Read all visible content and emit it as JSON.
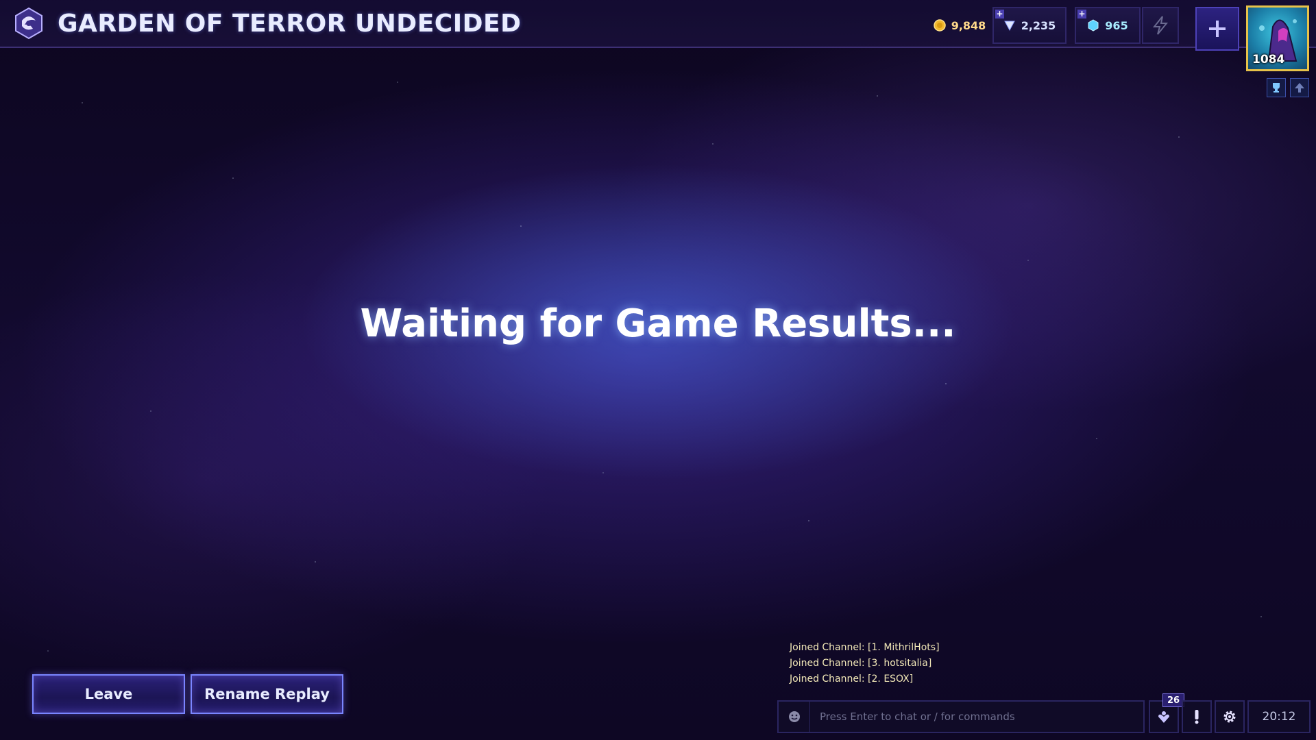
{
  "header": {
    "title": "GARDEN OF TERROR UNDECIDED",
    "logo_icon": "heroes-nexus-logo-icon"
  },
  "currencies": {
    "gold": "9,848",
    "gems": "2,235",
    "shards": "965",
    "gold_icon": "gold-coin-icon",
    "gems_icon": "gem-icon",
    "shards_icon": "shard-icon",
    "boost_icon": "lightning-boost-icon"
  },
  "profile": {
    "level": "1084",
    "add_icon": "plus-icon"
  },
  "main": {
    "status": "Waiting for Game Results..."
  },
  "actions": {
    "leave_label": "Leave",
    "rename_label": "Rename Replay"
  },
  "chat": {
    "messages": [
      "Joined Channel: [1. MithrilHots]",
      "Joined Channel: [3. hotsitalia]",
      "Joined Channel: [2. ESOX]"
    ],
    "placeholder": "Press Enter to chat or / for commands"
  },
  "footer": {
    "notification_count": "26",
    "clock": "20:12"
  },
  "colors": {
    "accent": "#7a86ff",
    "portrait_border": "#e7c24a",
    "gold_text": "#ffd98a",
    "chat_text": "#f3e9b8"
  }
}
